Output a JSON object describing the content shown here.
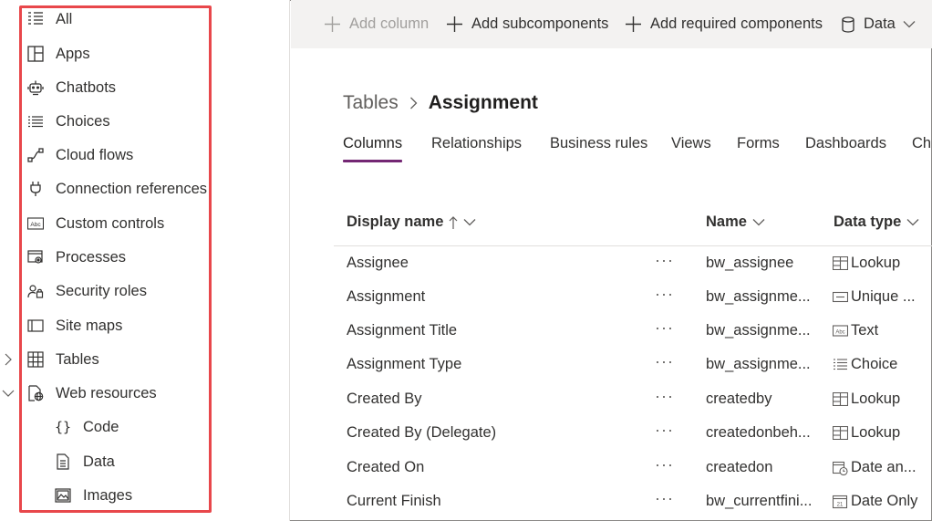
{
  "sidebar": {
    "items": [
      {
        "label": "All",
        "icon": "list-all-icon"
      },
      {
        "label": "Apps",
        "icon": "apps-icon"
      },
      {
        "label": "Chatbots",
        "icon": "chatbot-icon"
      },
      {
        "label": "Choices",
        "icon": "choices-icon"
      },
      {
        "label": "Cloud flows",
        "icon": "cloud-flow-icon"
      },
      {
        "label": "Connection references",
        "icon": "plug-icon"
      },
      {
        "label": "Custom controls",
        "icon": "custom-control-icon"
      },
      {
        "label": "Processes",
        "icon": "process-icon"
      },
      {
        "label": "Security roles",
        "icon": "security-roles-icon"
      },
      {
        "label": "Site maps",
        "icon": "site-map-icon"
      },
      {
        "label": "Tables",
        "icon": "table-icon"
      },
      {
        "label": "Web resources",
        "icon": "web-resource-icon"
      }
    ],
    "sub_items": [
      {
        "label": "Code",
        "icon": "braces-icon"
      },
      {
        "label": "Data",
        "icon": "document-icon"
      },
      {
        "label": "Images",
        "icon": "image-icon"
      }
    ]
  },
  "toolbar": {
    "add_column": "Add column",
    "add_subcomponents": "Add subcomponents",
    "add_required_components": "Add required components",
    "data": "Data"
  },
  "breadcrumb": {
    "root": "Tables",
    "current": "Assignment"
  },
  "tabs": [
    "Columns",
    "Relationships",
    "Business rules",
    "Views",
    "Forms",
    "Dashboards",
    "Ch"
  ],
  "grid": {
    "headers": {
      "display_name": "Display name",
      "name": "Name",
      "data_type": "Data type"
    },
    "more_glyph": "···",
    "rows": [
      {
        "display": "Assignee",
        "name": "bw_assignee",
        "type": "Lookup",
        "icon": "lookup-icon"
      },
      {
        "display": "Assignment",
        "name": "bw_assignme...",
        "type": "Unique ...",
        "icon": "unique-id-icon"
      },
      {
        "display": "Assignment Title",
        "name": "bw_assignme...",
        "type": "Text",
        "icon": "text-field-icon"
      },
      {
        "display": "Assignment Type",
        "name": "bw_assignme...",
        "type": "Choice",
        "icon": "choice-icon"
      },
      {
        "display": "Created By",
        "name": "createdby",
        "type": "Lookup",
        "icon": "lookup-icon"
      },
      {
        "display": "Created By (Delegate)",
        "name": "createdonbeh...",
        "type": "Lookup",
        "icon": "lookup-icon"
      },
      {
        "display": "Created On",
        "name": "createdon",
        "type": "Date an...",
        "icon": "date-time-icon"
      },
      {
        "display": "Current Finish",
        "name": "bw_currentfini...",
        "type": "Date Only",
        "icon": "date-only-icon"
      }
    ]
  }
}
